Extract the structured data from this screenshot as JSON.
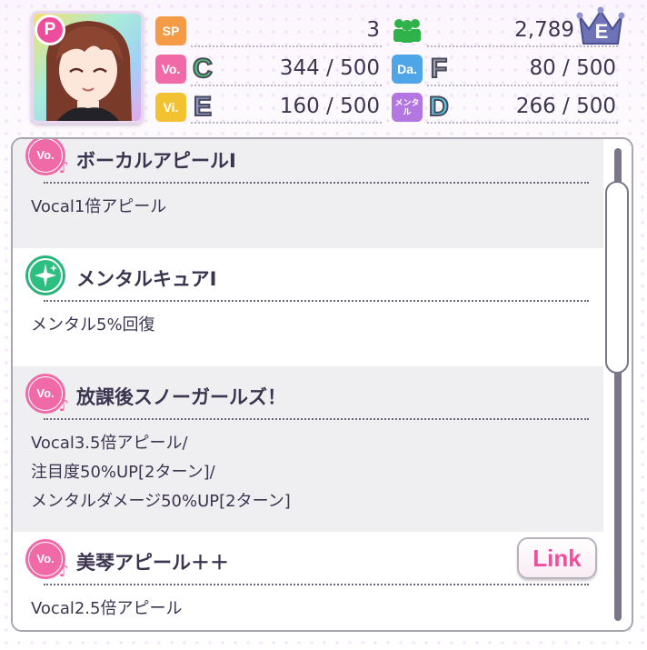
{
  "header": {
    "p_badge": "P",
    "crown_rank": "E",
    "stats": [
      {
        "tag": "SP",
        "tag_color": "#f59a47",
        "value": "3"
      },
      {
        "tag": "Vo.",
        "tag_color": "#f06aa8",
        "grade": "C",
        "grade_color": "#4cc87b",
        "value": "344 / 500"
      },
      {
        "tag": "Da.",
        "tag_color": "#4ea5e8",
        "grade": "F",
        "grade_color": "#9aa0ad",
        "value": "80 / 500"
      },
      {
        "tag": "Vi.",
        "tag_color": "#f3c233",
        "grade": "E",
        "grade_color": "#8e96c9",
        "value": "160 / 500"
      },
      {
        "tag": "メンタル",
        "tag_color": "#b476e0",
        "grade": "D",
        "grade_color": "#55c6e6",
        "value": "266 / 500"
      }
    ],
    "fans_value": "2,789"
  },
  "skills": [
    {
      "icon": "vocal-note-icon",
      "title": "ボーカルアピールⅠ",
      "desc": [
        "Vocal1倍アピール"
      ]
    },
    {
      "icon": "sparkle-cure-icon",
      "title": "メンタルキュアⅠ",
      "desc": [
        "メンタル5%回復"
      ]
    },
    {
      "icon": "vocal-note-icon",
      "title": "放課後スノーガールズ！",
      "desc": [
        "Vocal3.5倍アピール/",
        "注目度50%UP[2ターン]/",
        "メンタルダメージ50%UP[2ターン]"
      ]
    },
    {
      "icon": "vocal-note-icon",
      "title": "美琴アピール＋＋",
      "desc": [
        "Vocal2.5倍アピール"
      ],
      "link_label": "Link"
    }
  ],
  "colors": {
    "panel_border": "#a8a4b0",
    "shade_row": "#efeef1",
    "accent_pink": "#ef4f9d"
  }
}
